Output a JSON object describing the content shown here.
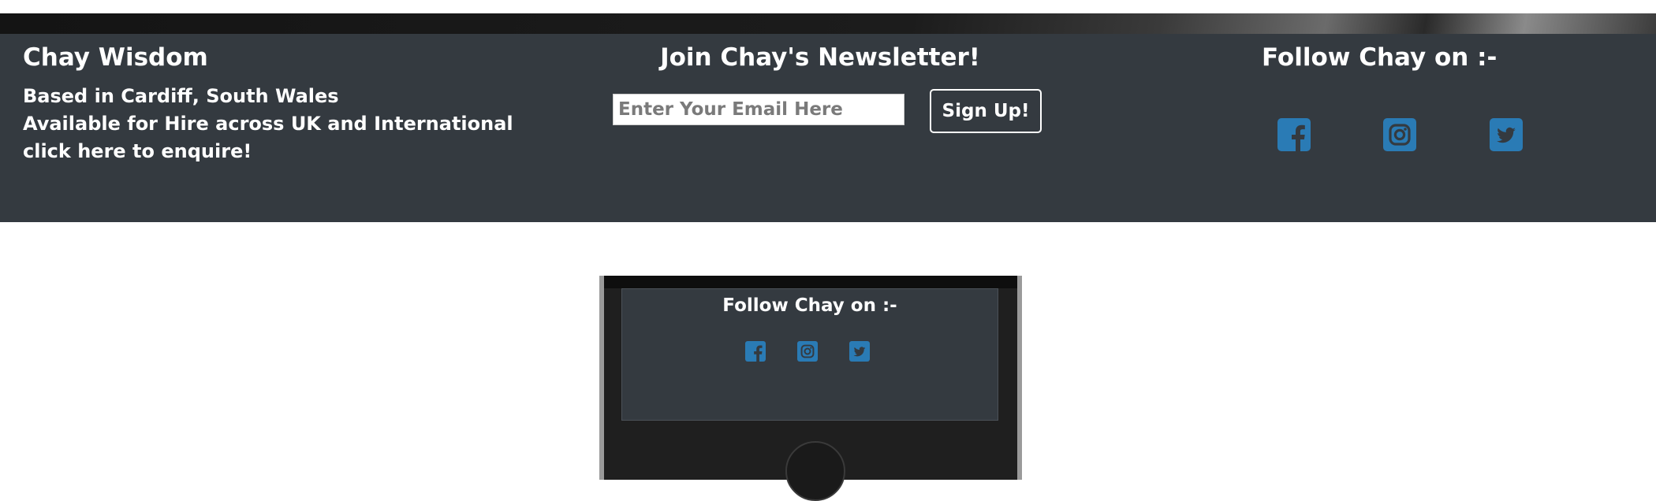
{
  "footer": {
    "brand": "Chay Wisdom",
    "location": "Based in Cardiff, South Wales",
    "availability": "Available for Hire across UK and International",
    "enquire_link": "click here to enquire!",
    "newsletter": {
      "heading": "Join Chay's Newsletter!",
      "email_placeholder": "Enter Your Email Here",
      "signup_label": "Sign Up!"
    },
    "social": {
      "heading": "Follow Chay on :-",
      "icons": [
        "facebook-icon",
        "instagram-icon",
        "twitter-icon"
      ]
    }
  },
  "mobile_preview": {
    "heading": "Follow Chay on :-",
    "icons": [
      "facebook-icon",
      "instagram-icon",
      "twitter-icon"
    ]
  },
  "colors": {
    "footer_bg": "#343a40",
    "social_icon": "#2a7bb5",
    "text": "#ffffff"
  }
}
